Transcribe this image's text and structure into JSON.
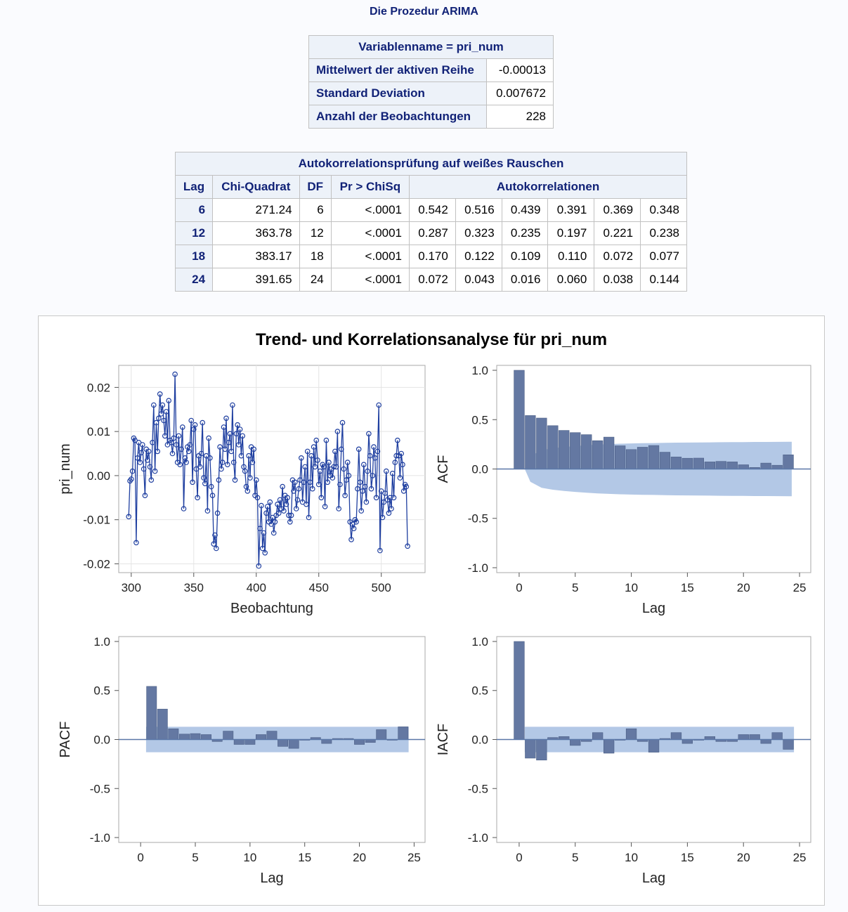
{
  "procedure_title": "Die Prozedur ARIMA",
  "variable_table": {
    "header": "Variablenname = pri_num",
    "rows": [
      {
        "label": "Mittelwert der aktiven Reihe",
        "value": "-0.00013"
      },
      {
        "label": "Standard Deviation",
        "value": "0.007672"
      },
      {
        "label": "Anzahl der Beobachtungen",
        "value": "228"
      }
    ]
  },
  "whitenoise_table": {
    "title": "Autokorrelationsprüfung auf weißes Rauschen",
    "columns": [
      "Lag",
      "Chi-Quadrat",
      "DF",
      "Pr > ChiSq",
      "Autokorrelationen"
    ],
    "rows": [
      {
        "lag": "6",
        "chisq": "271.24",
        "df": "6",
        "p": "<.0001",
        "acf": [
          "0.542",
          "0.516",
          "0.439",
          "0.391",
          "0.369",
          "0.348"
        ]
      },
      {
        "lag": "12",
        "chisq": "363.78",
        "df": "12",
        "p": "<.0001",
        "acf": [
          "0.287",
          "0.323",
          "0.235",
          "0.197",
          "0.221",
          "0.238"
        ]
      },
      {
        "lag": "18",
        "chisq": "383.17",
        "df": "18",
        "p": "<.0001",
        "acf": [
          "0.170",
          "0.122",
          "0.109",
          "0.110",
          "0.072",
          "0.077"
        ]
      },
      {
        "lag": "24",
        "chisq": "391.65",
        "df": "24",
        "p": "<.0001",
        "acf": [
          "0.072",
          "0.043",
          "0.016",
          "0.060",
          "0.038",
          "0.144"
        ]
      }
    ]
  },
  "figure_title": "Trend- und Korrelationsanalyse für pri_num",
  "colors": {
    "series": "#1f3fa0",
    "bar_fill": "#6478a2",
    "band_fill": "#b3c8e6",
    "header_text": "#112277",
    "header_bg": "#edf2f9"
  },
  "chart_data": [
    {
      "type": "line",
      "xlabel": "Beobachtung",
      "ylabel": "pri_num",
      "xlim": [
        290,
        535
      ],
      "ylim": [
        -0.022,
        0.025
      ],
      "xticks": [
        "300",
        "350",
        "400",
        "450",
        "500"
      ],
      "yticks": [
        "0.02",
        "0.01",
        "0.00",
        "-0.01",
        "-0.02"
      ],
      "grid": true,
      "x_start": 298,
      "y": [
        -0.0093,
        -0.0012,
        -0.0008,
        0.001,
        0.0085,
        0.008,
        -0.0152,
        0.004,
        0.0075,
        0.003,
        0.0052,
        0.007,
        0.0015,
        -0.0045,
        0.006,
        0.0035,
        0.0055,
        0.002,
        -0.001,
        0.0075,
        0.016,
        0.001,
        0.012,
        0.0055,
        0.013,
        0.0185,
        0.014,
        0.016,
        0.0125,
        0.009,
        0.0145,
        0.007,
        0.017,
        0.008,
        0.0075,
        0.005,
        0.0085,
        0.023,
        0.007,
        0.003,
        0.009,
        0.0025,
        0.006,
        0.011,
        -0.0075,
        0.004,
        0.003,
        0.0065,
        0.0055,
        0.007,
        0.0125,
        -0.0015,
        0.0105,
        0.0115,
        0.0015,
        -0.005,
        0.0045,
        0.002,
        0.005,
        0.012,
        -0.0005,
        -0.0018,
        0.0045,
        -0.008,
        0.0085,
        0.004,
        -0.0025,
        -0.0045,
        -0.0155,
        -0.0135,
        -0.0165,
        -0.0085,
        -0.001,
        0.0065,
        0.0015,
        0.003,
        0.011,
        0.006,
        0.013,
        0.0025,
        0.0075,
        0.0095,
        0.0055,
        0.016,
        0.003,
        -0.001,
        0.0095,
        0.0115,
        0.007,
        0.0105,
        0.0045,
        0.009,
        0.002,
        0.001,
        -0.0025,
        -0.0035,
        0.0045,
        -0.0005,
        0.0065,
        0.003,
        0.006,
        -0.0045,
        -0.001,
        -0.005,
        -0.0205,
        -0.012,
        -0.0068,
        -0.0165,
        -0.013,
        -0.0175,
        -0.0085,
        -0.007,
        -0.0105,
        -0.006,
        -0.011,
        -0.0095,
        -0.013,
        -0.0105,
        -0.009,
        -0.0065,
        -0.0085,
        -0.0055,
        -0.0075,
        -0.0025,
        -0.008,
        -0.0045,
        -0.0065,
        -0.005,
        -0.009,
        -0.0105,
        -0.009,
        -0.001,
        -0.0035,
        -0.0015,
        -0.0075,
        -0.0055,
        -0.003,
        -0.001,
        0.004,
        -0.006,
        -0.0015,
        0.002,
        -0.0065,
        0.0055,
        -0.0095,
        -0.0015,
        0.0045,
        -0.003,
        0.0065,
        0.002,
        0.008,
        0.0035,
        -0.002,
        0.001,
        -0.005,
        0.0025,
        0.002,
        -0.007,
        0.008,
        -0.0015,
        0.003,
        0.0,
        0.0015,
        -0.0005,
        0.002,
        0.0055,
        0.002,
        0.01,
        -0.0075,
        -0.002,
        0.006,
        0.012,
        0.0015,
        -0.0045,
        -0.001,
        0.003,
        0.0,
        -0.0105,
        -0.0145,
        -0.011,
        -0.012,
        -0.01,
        -0.0105,
        -0.003,
        0.006,
        -0.0015,
        -0.008,
        -0.0035,
        0.0025,
        -0.0025,
        -0.006,
        0.001,
        0.0095,
        0.0045,
        -0.003,
        0.0,
        0.0065,
        0.004,
        -0.005,
        0.0055,
        0.016,
        -0.017,
        -0.0035,
        -0.0095,
        -0.006,
        -0.004,
        0.001,
        -0.0055,
        -0.0085,
        -0.005,
        -0.0075,
        0.0005,
        -0.005,
        0.003,
        0.0045,
        0.008,
        0.0045,
        -0.0005,
        0.005,
        0.0025,
        -0.0035,
        -0.002,
        -0.0025,
        -0.016
      ]
    },
    {
      "type": "bar",
      "ylabel": "ACF",
      "xlabel": "Lag",
      "xlim": [
        -2,
        26
      ],
      "ylim": [
        -1.05,
        1.05
      ],
      "xticks": [
        "0",
        "5",
        "10",
        "15",
        "20",
        "25"
      ],
      "yticks": [
        "1.0",
        "0.5",
        "0.0",
        "-0.5",
        "-1.0"
      ],
      "lags": [
        0,
        1,
        2,
        3,
        4,
        5,
        6,
        7,
        8,
        9,
        10,
        11,
        12,
        13,
        14,
        15,
        16,
        17,
        18,
        19,
        20,
        21,
        22,
        23,
        24
      ],
      "values": [
        1.0,
        0.542,
        0.516,
        0.439,
        0.391,
        0.369,
        0.348,
        0.287,
        0.323,
        0.235,
        0.197,
        0.221,
        0.238,
        0.17,
        0.122,
        0.109,
        0.11,
        0.072,
        0.077,
        0.072,
        0.043,
        0.016,
        0.06,
        0.038,
        0.144
      ],
      "confidence_band": [
        0.13,
        0.19,
        0.21,
        0.222,
        0.232,
        0.24,
        0.247,
        0.252,
        0.256,
        0.259,
        0.261,
        0.263,
        0.265,
        0.267,
        0.268,
        0.269,
        0.27,
        0.271,
        0.272,
        0.273,
        0.274,
        0.274,
        0.275,
        0.276
      ]
    },
    {
      "type": "bar",
      "ylabel": "PACF",
      "xlabel": "Lag",
      "xlim": [
        -2,
        26
      ],
      "ylim": [
        -1.05,
        1.05
      ],
      "xticks": [
        "0",
        "5",
        "10",
        "15",
        "20",
        "25"
      ],
      "yticks": [
        "1.0",
        "0.5",
        "0.0",
        "-0.5",
        "-1.0"
      ],
      "lags": [
        1,
        2,
        3,
        4,
        5,
        6,
        7,
        8,
        9,
        10,
        11,
        12,
        13,
        14,
        15,
        16,
        17,
        18,
        19,
        20,
        21,
        22,
        23,
        24
      ],
      "values": [
        0.542,
        0.31,
        0.11,
        0.055,
        0.06,
        0.05,
        -0.02,
        0.085,
        -0.05,
        -0.05,
        0.05,
        0.085,
        -0.07,
        -0.09,
        0.0,
        0.02,
        -0.04,
        0.01,
        0.01,
        -0.05,
        -0.03,
        0.1,
        0.0,
        0.13
      ],
      "confidence_band": [
        0.13
      ]
    },
    {
      "type": "bar",
      "ylabel": "IACF",
      "xlabel": "Lag",
      "xlim": [
        -2,
        26
      ],
      "ylim": [
        -1.05,
        1.05
      ],
      "xticks": [
        "0",
        "5",
        "10",
        "15",
        "20",
        "25"
      ],
      "yticks": [
        "1.0",
        "0.5",
        "0.0",
        "-0.5",
        "-1.0"
      ],
      "lags": [
        0,
        1,
        2,
        3,
        4,
        5,
        6,
        7,
        8,
        9,
        10,
        11,
        12,
        13,
        14,
        15,
        16,
        17,
        18,
        19,
        20,
        21,
        22,
        23,
        24
      ],
      "values": [
        1.0,
        -0.19,
        -0.21,
        0.02,
        0.03,
        -0.06,
        -0.02,
        0.07,
        -0.14,
        0.0,
        0.11,
        -0.02,
        -0.13,
        0.01,
        0.07,
        -0.04,
        0.0,
        0.03,
        -0.02,
        -0.02,
        0.05,
        0.05,
        -0.04,
        0.07,
        -0.1
      ],
      "confidence_band": [
        0.13
      ]
    }
  ]
}
